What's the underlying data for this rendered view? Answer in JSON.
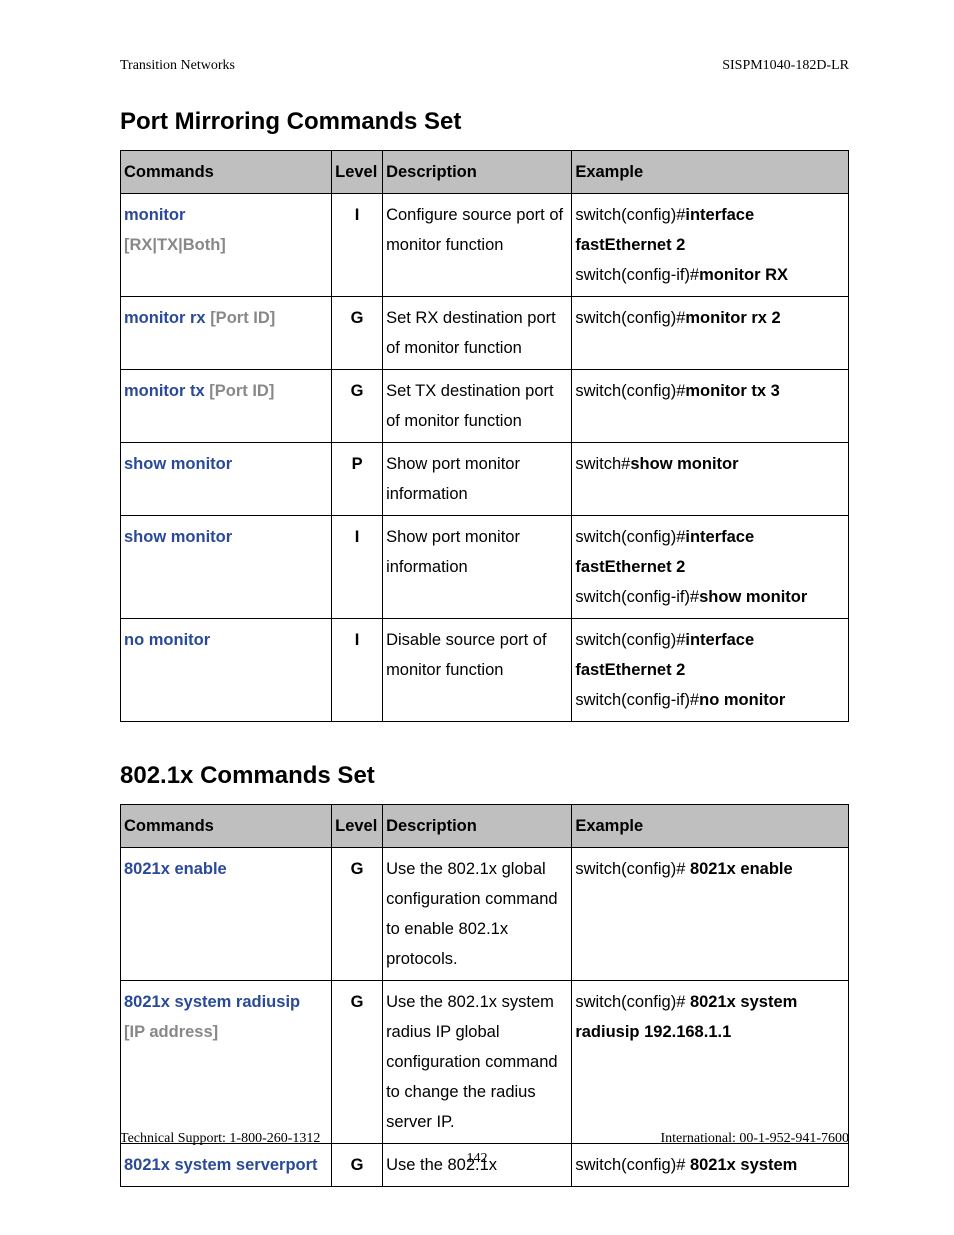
{
  "header": {
    "left": "Transition Networks",
    "right": "SISPM1040-182D-LR"
  },
  "footer": {
    "left": "Technical Support: 1-800-260-1312",
    "right": "International: 00-1-952-941-7600",
    "page": "142"
  },
  "sections": [
    {
      "title": "Port Mirroring Commands Set",
      "columns": [
        "Commands",
        "Level",
        "Description",
        "Example"
      ],
      "rows": [
        {
          "cmd": [
            {
              "t": "monitor",
              "c": "link"
            },
            {
              "t": "[RX|TX|Both]",
              "c": "param",
              "nl": true
            }
          ],
          "level": "I",
          "desc": "Configure source port of monitor function",
          "example": [
            {
              "t": "switch(config)#"
            },
            {
              "t": "interface fastEthernet 2",
              "c": "bold"
            },
            {
              "t": "switch(config-if)#",
              "nl": true
            },
            {
              "t": "monitor RX",
              "c": "bold"
            }
          ]
        },
        {
          "cmd": [
            {
              "t": "monitor rx",
              "c": "link"
            },
            {
              "t": " "
            },
            {
              "t": "[Port ID]",
              "c": "param"
            }
          ],
          "level": "G",
          "desc": "Set RX destination port of monitor function",
          "example": [
            {
              "t": "switch(config)#"
            },
            {
              "t": "monitor rx 2",
              "c": "bold"
            }
          ]
        },
        {
          "cmd": [
            {
              "t": "monitor tx",
              "c": "link"
            },
            {
              "t": " "
            },
            {
              "t": "[Port ID]",
              "c": "param"
            }
          ],
          "level": "G",
          "desc": "Set TX destination port of monitor function",
          "example": [
            {
              "t": "switch(config)#"
            },
            {
              "t": "monitor tx 3",
              "c": "bold"
            }
          ]
        },
        {
          "cmd": [
            {
              "t": "show monitor",
              "c": "link"
            }
          ],
          "level": "P",
          "desc": "Show port monitor information",
          "example": [
            {
              "t": "switch#"
            },
            {
              "t": "show monitor",
              "c": "bold"
            }
          ]
        },
        {
          "cmd": [
            {
              "t": "show monitor",
              "c": "link"
            }
          ],
          "level": "I",
          "desc": "Show port monitor information",
          "example": [
            {
              "t": "switch(config)#"
            },
            {
              "t": "interface fastEthernet 2",
              "c": "bold"
            },
            {
              "t": "switch(config-if)#",
              "nl": true
            },
            {
              "t": "show monitor",
              "c": "bold"
            }
          ]
        },
        {
          "cmd": [
            {
              "t": "no monitor",
              "c": "link"
            }
          ],
          "level": "I",
          "desc": "Disable source port of monitor function",
          "example": [
            {
              "t": "switch(config)#"
            },
            {
              "t": "interface fastEthernet 2",
              "c": "bold"
            },
            {
              "t": "switch(config-if)#",
              "nl": true
            },
            {
              "t": "no monitor",
              "c": "bold"
            }
          ]
        }
      ]
    },
    {
      "title": "802.1x Commands Set",
      "columns": [
        "Commands",
        "Level",
        "Description",
        "Example"
      ],
      "rows": [
        {
          "cmd": [
            {
              "t": "8021x enable",
              "c": "link"
            }
          ],
          "level": "G",
          "desc": "Use the 802.1x global configuration command to enable 802.1x protocols.",
          "example": [
            {
              "t": "switch(config)# "
            },
            {
              "t": "8021x enable",
              "c": "bold"
            }
          ]
        },
        {
          "cmd": [
            {
              "t": "8021x system radiusip",
              "c": "link"
            },
            {
              "t": "[IP address]",
              "c": "param",
              "nl": true
            }
          ],
          "level": "G",
          "desc": "Use the 802.1x system radius IP global configuration command to change the radius server IP.",
          "example": [
            {
              "t": "switch(config)# "
            },
            {
              "t": "8021x system radiusip 192.168.1.1",
              "c": "bold"
            }
          ]
        },
        {
          "cmd": [
            {
              "t": "8021x system serverport",
              "c": "link"
            }
          ],
          "level": "G",
          "desc": "Use the 802.1x",
          "example": [
            {
              "t": "switch(config)# "
            },
            {
              "t": "8021x system",
              "c": "bold"
            }
          ]
        }
      ]
    }
  ]
}
